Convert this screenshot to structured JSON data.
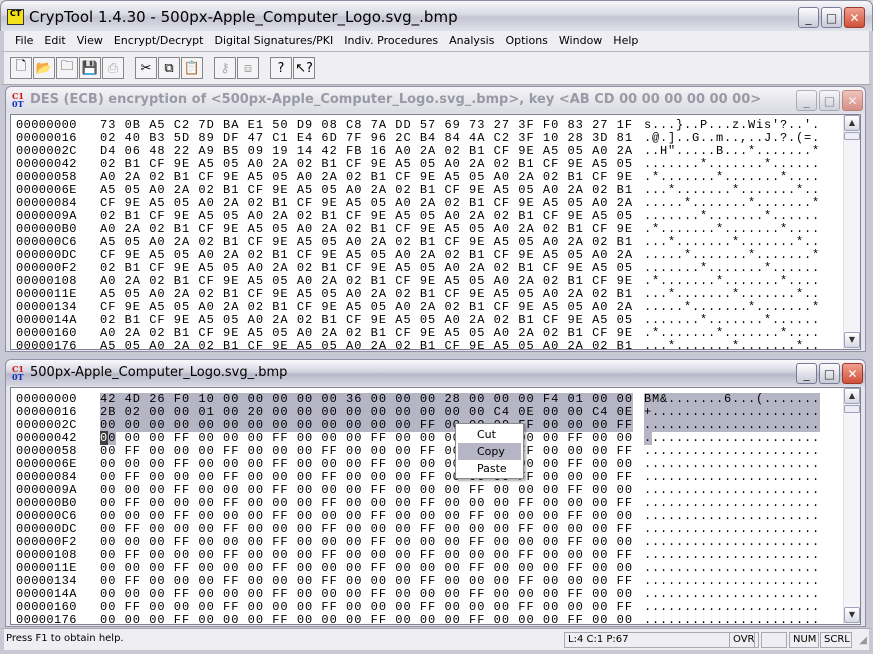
{
  "app": {
    "title": "CrypTool 1.4.30 - 500px-Apple_Computer_Logo.svg_.bmp",
    "icon_text": "CT"
  },
  "window_buttons": {
    "minimize": "_",
    "maximize": "□",
    "close": "✕"
  },
  "menu": [
    "File",
    "Edit",
    "View",
    "Encrypt/Decrypt",
    "Digital Signatures/PKI",
    "Indiv. Procedures",
    "Analysis",
    "Options",
    "Window",
    "Help"
  ],
  "toolbar": [
    {
      "name": "new-icon",
      "glyph": "🗋",
      "enabled": true
    },
    {
      "name": "open-icon",
      "glyph": "📂",
      "enabled": true
    },
    {
      "name": "open-folder-icon",
      "glyph": "🗀",
      "enabled": true
    },
    {
      "name": "save-icon",
      "glyph": "💾",
      "enabled": true
    },
    {
      "name": "print-icon",
      "glyph": "⎙",
      "enabled": false
    },
    {
      "sep": true
    },
    {
      "name": "cut-icon",
      "glyph": "✂",
      "enabled": true
    },
    {
      "name": "copy-icon",
      "glyph": "⧉",
      "enabled": true
    },
    {
      "name": "paste-icon",
      "glyph": "📋",
      "enabled": true
    },
    {
      "sep": true
    },
    {
      "name": "key-icon",
      "glyph": "⚷",
      "enabled": false
    },
    {
      "name": "window-icon",
      "glyph": "⧈",
      "enabled": false
    },
    {
      "sep": true
    },
    {
      "name": "help-icon",
      "glyph": "?",
      "enabled": true
    },
    {
      "name": "context-help-icon",
      "glyph": "↖?",
      "enabled": true
    }
  ],
  "windows": [
    {
      "title": "DES (ECB) encryption of <500px-Apple_Computer_Logo.svg_.bmp>, key <AB CD 00 00 00 00 00 00>",
      "icon_text": [
        "C1",
        "0T"
      ],
      "rows": [
        {
          "offset": "00000000",
          "hex": "73 0B A5 C2 7D BA E1 50 D9 08 C8 7A DD 57 69 73 27 3F F0 83 27 1F",
          "ascii": "s...}..P...z.Wis'?..'."
        },
        {
          "offset": "00000016",
          "hex": "02 40 B3 5D 89 DF 47 C1 E4 6D 7F 96 2C B4 84 4A C2 3F 10 28 3D 81",
          "ascii": ".@.]..G..m..,..J.?.(=."
        },
        {
          "offset": "0000002C",
          "hex": "D4 06 48 22 A9 B5 09 19 14 42 FB 16 A0 2A 02 B1 CF 9E A5 05 A0 2A",
          "ascii": "..H\".....B...*.......*"
        },
        {
          "offset": "00000042",
          "hex": "02 B1 CF 9E A5 05 A0 2A 02 B1 CF 9E A5 05 A0 2A 02 B1 CF 9E A5 05",
          "ascii": ".......*.......*......"
        },
        {
          "offset": "00000058",
          "hex": "A0 2A 02 B1 CF 9E A5 05 A0 2A 02 B1 CF 9E A5 05 A0 2A 02 B1 CF 9E",
          "ascii": ".*.......*.......*...."
        },
        {
          "offset": "0000006E",
          "hex": "A5 05 A0 2A 02 B1 CF 9E A5 05 A0 2A 02 B1 CF 9E A5 05 A0 2A 02 B1",
          "ascii": "...*.......*.......*.."
        },
        {
          "offset": "00000084",
          "hex": "CF 9E A5 05 A0 2A 02 B1 CF 9E A5 05 A0 2A 02 B1 CF 9E A5 05 A0 2A",
          "ascii": ".....*.......*.......*"
        },
        {
          "offset": "0000009A",
          "hex": "02 B1 CF 9E A5 05 A0 2A 02 B1 CF 9E A5 05 A0 2A 02 B1 CF 9E A5 05",
          "ascii": ".......*.......*......"
        },
        {
          "offset": "000000B0",
          "hex": "A0 2A 02 B1 CF 9E A5 05 A0 2A 02 B1 CF 9E A5 05 A0 2A 02 B1 CF 9E",
          "ascii": ".*.......*.......*...."
        },
        {
          "offset": "000000C6",
          "hex": "A5 05 A0 2A 02 B1 CF 9E A5 05 A0 2A 02 B1 CF 9E A5 05 A0 2A 02 B1",
          "ascii": "...*.......*.......*.."
        },
        {
          "offset": "000000DC",
          "hex": "CF 9E A5 05 A0 2A 02 B1 CF 9E A5 05 A0 2A 02 B1 CF 9E A5 05 A0 2A",
          "ascii": ".....*.......*.......*"
        },
        {
          "offset": "000000F2",
          "hex": "02 B1 CF 9E A5 05 A0 2A 02 B1 CF 9E A5 05 A0 2A 02 B1 CF 9E A5 05",
          "ascii": ".......*.......*......"
        },
        {
          "offset": "00000108",
          "hex": "A0 2A 02 B1 CF 9E A5 05 A0 2A 02 B1 CF 9E A5 05 A0 2A 02 B1 CF 9E",
          "ascii": ".*.......*.......*...."
        },
        {
          "offset": "0000011E",
          "hex": "A5 05 A0 2A 02 B1 CF 9E A5 05 A0 2A 02 B1 CF 9E A5 05 A0 2A 02 B1",
          "ascii": "...*.......*.......*.."
        },
        {
          "offset": "00000134",
          "hex": "CF 9E A5 05 A0 2A 02 B1 CF 9E A5 05 A0 2A 02 B1 CF 9E A5 05 A0 2A",
          "ascii": ".....*.......*.......*"
        },
        {
          "offset": "0000014A",
          "hex": "02 B1 CF 9E A5 05 A0 2A 02 B1 CF 9E A5 05 A0 2A 02 B1 CF 9E A5 05",
          "ascii": ".......*.......*......"
        },
        {
          "offset": "00000160",
          "hex": "A0 2A 02 B1 CF 9E A5 05 A0 2A 02 B1 CF 9E A5 05 A0 2A 02 B1 CF 9E",
          "ascii": ".*.......*.......*...."
        },
        {
          "offset": "00000176",
          "hex": "A5 05 A0 2A 02 B1 CF 9E A5 05 A0 2A 02 B1 CF 9E A5 05 A0 2A 02 B1",
          "ascii": "...*.......*.......*.."
        }
      ]
    },
    {
      "title": "500px-Apple_Computer_Logo.svg_.bmp",
      "icon_text": [
        "C1",
        "0T"
      ],
      "selected_rows": [
        0,
        1,
        2
      ],
      "cursor_row": 3,
      "rows": [
        {
          "offset": "00000000",
          "hex": "42 4D 26 F0 10 00 00 00 00 00 36 00 00 00 28 00 00 00 F4 01 00 00",
          "ascii": "BM&.......6...(......."
        },
        {
          "offset": "00000016",
          "hex": "2B 02 00 00 01 00 20 00 00 00 00 00 00 00 00 00 C4 0E 00 00 C4 0E",
          "ascii": "+....................."
        },
        {
          "offset": "0000002C",
          "hex": "00 00 00 00 00 00 00 00 00 00 00 00 00 FF 00 00 00 FF 00 00 00 FF",
          "ascii": "......................"
        },
        {
          "offset": "00000042",
          "hex": "00 00 00 FF 00 00 00 FF 00 00 00 FF 00 00 00 FF 00 00 00 FF 00 00",
          "ascii": "......................"
        },
        {
          "offset": "00000058",
          "hex": "00 FF 00 00 00 FF 00 00 00 FF 00 00 00 FF 00 00 00 FF 00 00 00 FF",
          "ascii": "......................"
        },
        {
          "offset": "0000006E",
          "hex": "00 00 00 FF 00 00 00 FF 00 00 00 FF 00 00 00 FF 00 00 00 FF 00 00",
          "ascii": "......................"
        },
        {
          "offset": "00000084",
          "hex": "00 FF 00 00 00 FF 00 00 00 FF 00 00 00 FF 00 00 00 FF 00 00 00 FF",
          "ascii": "......................"
        },
        {
          "offset": "0000009A",
          "hex": "00 00 00 FF 00 00 00 FF 00 00 00 FF 00 00 00 FF 00 00 00 FF 00 00",
          "ascii": "......................"
        },
        {
          "offset": "000000B0",
          "hex": "00 FF 00 00 00 FF 00 00 00 FF 00 00 00 FF 00 00 00 FF 00 00 00 FF",
          "ascii": "......................"
        },
        {
          "offset": "000000C6",
          "hex": "00 00 00 FF 00 00 00 FF 00 00 00 FF 00 00 00 FF 00 00 00 FF 00 00",
          "ascii": "......................"
        },
        {
          "offset": "000000DC",
          "hex": "00 FF 00 00 00 FF 00 00 00 FF 00 00 00 FF 00 00 00 FF 00 00 00 FF",
          "ascii": "......................"
        },
        {
          "offset": "000000F2",
          "hex": "00 00 00 FF 00 00 00 FF 00 00 00 FF 00 00 00 FF 00 00 00 FF 00 00",
          "ascii": "......................"
        },
        {
          "offset": "00000108",
          "hex": "00 FF 00 00 00 FF 00 00 00 FF 00 00 00 FF 00 00 00 FF 00 00 00 FF",
          "ascii": "......................"
        },
        {
          "offset": "0000011E",
          "hex": "00 00 00 FF 00 00 00 FF 00 00 00 FF 00 00 00 FF 00 00 00 FF 00 00",
          "ascii": "......................"
        },
        {
          "offset": "00000134",
          "hex": "00 FF 00 00 00 FF 00 00 00 FF 00 00 00 FF 00 00 00 FF 00 00 00 FF",
          "ascii": "......................"
        },
        {
          "offset": "0000014A",
          "hex": "00 00 00 FF 00 00 00 FF 00 00 00 FF 00 00 00 FF 00 00 00 FF 00 00",
          "ascii": "......................"
        },
        {
          "offset": "00000160",
          "hex": "00 FF 00 00 00 FF 00 00 00 FF 00 00 00 FF 00 00 00 FF 00 00 00 FF",
          "ascii": "......................"
        },
        {
          "offset": "00000176",
          "hex": "00 00 00 FF 00 00 00 FF 00 00 00 FF 00 00 00 FF 00 00 00 FF 00 00",
          "ascii": "......................"
        }
      ]
    }
  ],
  "context_menu": {
    "items": [
      "Cut",
      "Copy",
      "Paste"
    ],
    "highlighted": "Copy"
  },
  "statusbar": {
    "help": "Press F1 to obtain help.",
    "position": "L:4  C:1  P:67",
    "ovr": "OVR",
    "caps": "",
    "num": "NUM",
    "scrl": "SCRL"
  },
  "colors": {
    "selection": "#b5b5c6",
    "close_button": "#d0503a"
  }
}
